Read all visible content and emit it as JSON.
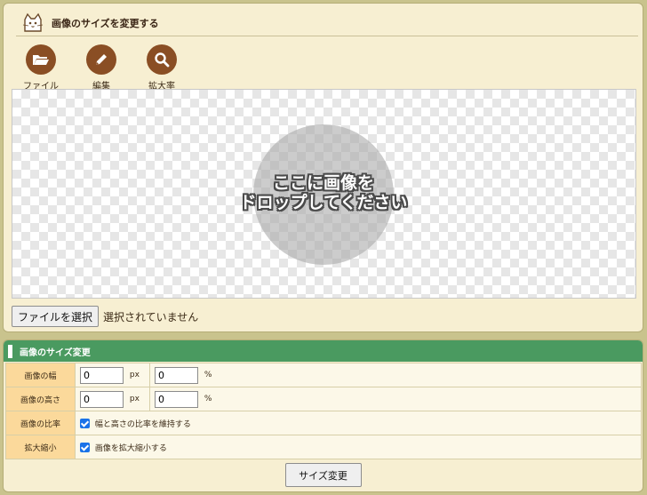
{
  "header": {
    "title": "画像のサイズを変更する",
    "logo_icon": "cat-logo-icon"
  },
  "toolbar": [
    {
      "label": "ファイル",
      "icon": "folder-open-icon"
    },
    {
      "label": "編集",
      "icon": "pencil-icon"
    },
    {
      "label": "拡大率",
      "icon": "magnifier-icon"
    }
  ],
  "dropzone": {
    "line1": "ここに画像を",
    "line2": "ドロップしてください"
  },
  "file": {
    "button_label": "ファイルを選択",
    "status": "選択されていません"
  },
  "resize": {
    "section_title": "画像のサイズ変更",
    "width": {
      "label": "画像の幅",
      "px_value": "0",
      "px_unit": "px",
      "pct_value": "0",
      "pct_unit": "%"
    },
    "height": {
      "label": "画像の高さ",
      "px_value": "0",
      "px_unit": "px",
      "pct_value": "0",
      "pct_unit": "%"
    },
    "ratio": {
      "label": "画像の比率",
      "checkbox_label": "幅と高さの比率を維持する",
      "checked": true
    },
    "scale": {
      "label": "拡大縮小",
      "checkbox_label": "画像を拡大縮小する",
      "checked": true
    },
    "submit_label": "サイズ変更"
  },
  "colors": {
    "brown_accent": "#8a4e24",
    "section_green": "#4a9a60",
    "panel_bg": "#f7efd2",
    "label_cell_bg": "#fbd99b"
  }
}
